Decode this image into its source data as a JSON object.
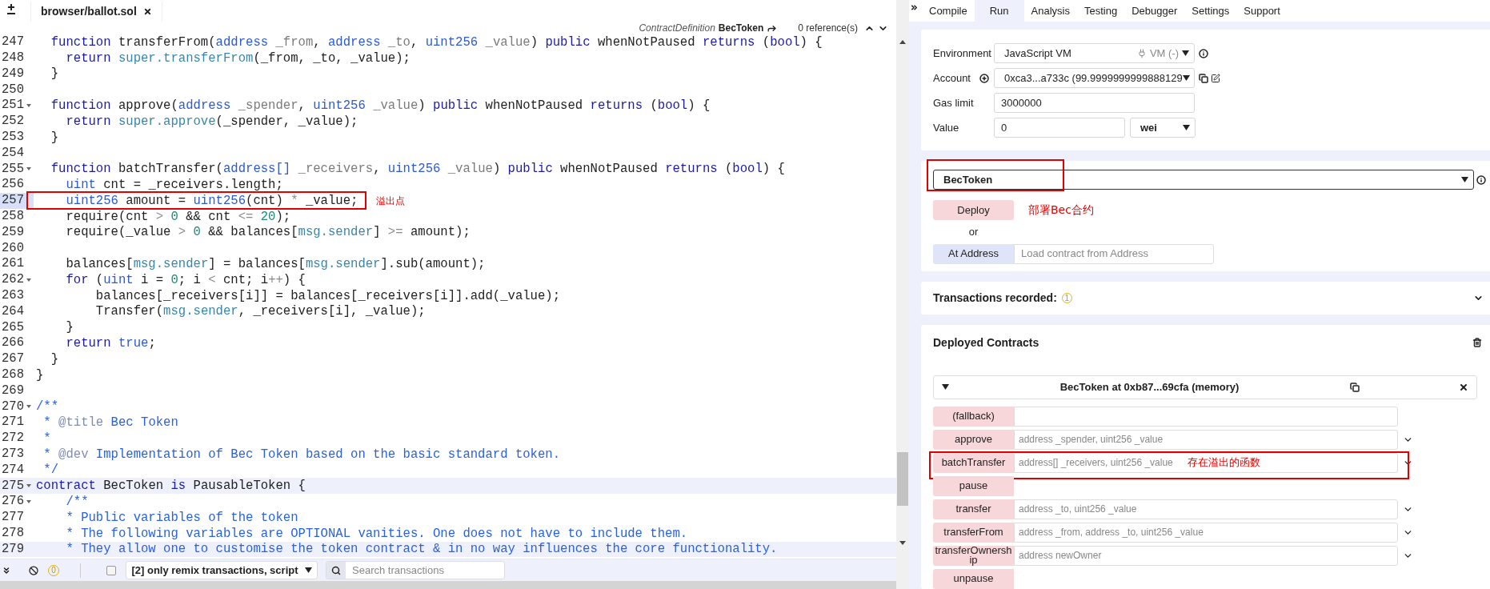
{
  "editor": {
    "file_tab": "browser/ballot.sol",
    "reference_bar": {
      "definition": "ContractDefinition",
      "name": "BecToken",
      "references": "0 reference(s)"
    },
    "lines": [
      {
        "number": "247",
        "foldable": false,
        "selected": false,
        "highlighted": false,
        "segments": [
          {
            "text": "  function",
            "kind": "keyword"
          },
          {
            "text": " transferFrom(",
            "kind": "plain"
          },
          {
            "text": "address",
            "kind": "type"
          },
          {
            "text": " _from",
            "kind": "param"
          },
          {
            "text": ", ",
            "kind": "plain"
          },
          {
            "text": "address",
            "kind": "type"
          },
          {
            "text": " _to",
            "kind": "param"
          },
          {
            "text": ", ",
            "kind": "plain"
          },
          {
            "text": "uint256",
            "kind": "type"
          },
          {
            "text": " _value",
            "kind": "param"
          },
          {
            "text": ") ",
            "kind": "plain"
          },
          {
            "text": "public",
            "kind": "keyword"
          },
          {
            "text": " whenNotPaused ",
            "kind": "plain"
          },
          {
            "text": "returns",
            "kind": "keyword"
          },
          {
            "text": " (",
            "kind": "plain"
          },
          {
            "text": "bool",
            "kind": "keyword"
          },
          {
            "text": ") {",
            "kind": "plain"
          }
        ]
      },
      {
        "number": "248",
        "foldable": false,
        "selected": false,
        "highlighted": false,
        "segments": [
          {
            "text": "    return",
            "kind": "keyword"
          },
          {
            "text": " super.transferFrom",
            "kind": "builtin"
          },
          {
            "text": "(_from, _to, _value);",
            "kind": "plain"
          }
        ]
      },
      {
        "number": "249",
        "foldable": false,
        "selected": false,
        "highlighted": false,
        "segments": [
          {
            "text": "  }",
            "kind": "plain"
          }
        ]
      },
      {
        "number": "250",
        "foldable": false,
        "selected": false,
        "highlighted": false
      },
      {
        "number": "251",
        "foldable": true,
        "selected": false,
        "highlighted": false,
        "segments": [
          {
            "text": "  function",
            "kind": "keyword"
          },
          {
            "text": " approve(",
            "kind": "plain"
          },
          {
            "text": "address",
            "kind": "type"
          },
          {
            "text": " _spender",
            "kind": "param"
          },
          {
            "text": ", ",
            "kind": "plain"
          },
          {
            "text": "uint256",
            "kind": "type"
          },
          {
            "text": " _value",
            "kind": "param"
          },
          {
            "text": ") ",
            "kind": "plain"
          },
          {
            "text": "public",
            "kind": "keyword"
          },
          {
            "text": " whenNotPaused ",
            "kind": "plain"
          },
          {
            "text": "returns",
            "kind": "keyword"
          },
          {
            "text": " (",
            "kind": "plain"
          },
          {
            "text": "bool",
            "kind": "keyword"
          },
          {
            "text": ") {",
            "kind": "plain"
          }
        ]
      },
      {
        "number": "252",
        "foldable": false,
        "selected": false,
        "highlighted": false,
        "segments": [
          {
            "text": "    return",
            "kind": "keyword"
          },
          {
            "text": " super.approve",
            "kind": "builtin"
          },
          {
            "text": "(_spender, _value);",
            "kind": "plain"
          }
        ]
      },
      {
        "number": "253",
        "foldable": false,
        "selected": false,
        "highlighted": false,
        "segments": [
          {
            "text": "  }",
            "kind": "plain"
          }
        ]
      },
      {
        "number": "254",
        "foldable": false,
        "selected": false,
        "highlighted": false
      },
      {
        "number": "255",
        "foldable": true,
        "selected": false,
        "highlighted": false,
        "segments": [
          {
            "text": "  function",
            "kind": "keyword"
          },
          {
            "text": " batchTransfer(",
            "kind": "plain"
          },
          {
            "text": "address[]",
            "kind": "type"
          },
          {
            "text": " _receivers",
            "kind": "param"
          },
          {
            "text": ", ",
            "kind": "plain"
          },
          {
            "text": "uint256",
            "kind": "type"
          },
          {
            "text": " _value",
            "kind": "param"
          },
          {
            "text": ") ",
            "kind": "plain"
          },
          {
            "text": "public",
            "kind": "keyword"
          },
          {
            "text": " whenNotPaused ",
            "kind": "plain"
          },
          {
            "text": "returns",
            "kind": "keyword"
          },
          {
            "text": " (",
            "kind": "plain"
          },
          {
            "text": "bool",
            "kind": "keyword"
          },
          {
            "text": ") {",
            "kind": "plain"
          }
        ]
      },
      {
        "number": "256",
        "foldable": false,
        "selected": false,
        "highlighted": false,
        "segments": [
          {
            "text": "    uint",
            "kind": "type"
          },
          {
            "text": " cnt = _receivers.length;",
            "kind": "plain"
          }
        ]
      },
      {
        "number": "257",
        "foldable": false,
        "selected": true,
        "highlighted": false,
        "annotation": "溢出点",
        "segments": [
          {
            "text": "    uint256",
            "kind": "type"
          },
          {
            "text": " amount = ",
            "kind": "plain"
          },
          {
            "text": "uint256",
            "kind": "type"
          },
          {
            "text": "(cnt) ",
            "kind": "plain"
          },
          {
            "text": "*",
            "kind": "operator"
          },
          {
            "text": " _value;",
            "kind": "plain"
          }
        ]
      },
      {
        "number": "258",
        "foldable": false,
        "selected": false,
        "highlighted": false,
        "segments": [
          {
            "text": "    require(cnt ",
            "kind": "plain"
          },
          {
            "text": ">",
            "kind": "operator"
          },
          {
            "text": " 0",
            "kind": "number"
          },
          {
            "text": " && cnt ",
            "kind": "plain"
          },
          {
            "text": "<=",
            "kind": "operator"
          },
          {
            "text": " 20",
            "kind": "number"
          },
          {
            "text": ");",
            "kind": "plain"
          }
        ]
      },
      {
        "number": "259",
        "foldable": false,
        "selected": false,
        "highlighted": false,
        "segments": [
          {
            "text": "    require(_value ",
            "kind": "plain"
          },
          {
            "text": ">",
            "kind": "operator"
          },
          {
            "text": " 0",
            "kind": "number"
          },
          {
            "text": " && balances[",
            "kind": "plain"
          },
          {
            "text": "msg.sender",
            "kind": "builtin"
          },
          {
            "text": "] ",
            "kind": "plain"
          },
          {
            "text": ">=",
            "kind": "operator"
          },
          {
            "text": " amount);",
            "kind": "plain"
          }
        ]
      },
      {
        "number": "260",
        "foldable": false,
        "selected": false,
        "highlighted": false
      },
      {
        "number": "261",
        "foldable": false,
        "selected": false,
        "highlighted": false,
        "segments": [
          {
            "text": "    balances[",
            "kind": "plain"
          },
          {
            "text": "msg.sender",
            "kind": "builtin"
          },
          {
            "text": "] = balances[",
            "kind": "plain"
          },
          {
            "text": "msg.sender",
            "kind": "builtin"
          },
          {
            "text": "].sub(amount);",
            "kind": "plain"
          }
        ]
      },
      {
        "number": "262",
        "foldable": true,
        "selected": false,
        "highlighted": false,
        "segments": [
          {
            "text": "    for",
            "kind": "keyword"
          },
          {
            "text": " (",
            "kind": "plain"
          },
          {
            "text": "uint",
            "kind": "type"
          },
          {
            "text": " i = ",
            "kind": "plain"
          },
          {
            "text": "0",
            "kind": "number"
          },
          {
            "text": "; i ",
            "kind": "plain"
          },
          {
            "text": "<",
            "kind": "operator"
          },
          {
            "text": " cnt; i",
            "kind": "plain"
          },
          {
            "text": "++",
            "kind": "operator"
          },
          {
            "text": ") {",
            "kind": "plain"
          }
        ]
      },
      {
        "number": "263",
        "foldable": false,
        "selected": false,
        "highlighted": false,
        "segments": [
          {
            "text": "        balances[_receivers[i]] = balances[_receivers[i]].add(_value);",
            "kind": "plain"
          }
        ]
      },
      {
        "number": "264",
        "foldable": false,
        "selected": false,
        "highlighted": false,
        "segments": [
          {
            "text": "        Transfer(",
            "kind": "plain"
          },
          {
            "text": "msg.sender",
            "kind": "builtin"
          },
          {
            "text": ", _receivers[i], _value);",
            "kind": "plain"
          }
        ]
      },
      {
        "number": "265",
        "foldable": false,
        "selected": false,
        "highlighted": false,
        "segments": [
          {
            "text": "    }",
            "kind": "plain"
          }
        ]
      },
      {
        "number": "266",
        "foldable": false,
        "selected": false,
        "highlighted": false,
        "segments": [
          {
            "text": "    return",
            "kind": "keyword"
          },
          {
            "text": " true",
            "kind": "type"
          },
          {
            "text": ";",
            "kind": "plain"
          }
        ]
      },
      {
        "number": "267",
        "foldable": false,
        "selected": false,
        "highlighted": false,
        "segments": [
          {
            "text": "  }",
            "kind": "plain"
          }
        ]
      },
      {
        "number": "268",
        "foldable": false,
        "selected": false,
        "highlighted": false,
        "segments": [
          {
            "text": "}",
            "kind": "plain"
          }
        ]
      },
      {
        "number": "269",
        "foldable": false,
        "selected": false,
        "highlighted": false
      },
      {
        "number": "270",
        "foldable": true,
        "selected": false,
        "highlighted": false,
        "segments": [
          {
            "text": "/**",
            "kind": "comment"
          }
        ]
      },
      {
        "number": "271",
        "foldable": false,
        "selected": false,
        "highlighted": false,
        "segments": [
          {
            "text": " * ",
            "kind": "comment"
          },
          {
            "text": "@title",
            "kind": "doctag"
          },
          {
            "text": " Bec Token",
            "kind": "comment"
          }
        ]
      },
      {
        "number": "272",
        "foldable": false,
        "selected": false,
        "highlighted": false,
        "segments": [
          {
            "text": " *",
            "kind": "comment"
          }
        ]
      },
      {
        "number": "273",
        "foldable": false,
        "selected": false,
        "highlighted": false,
        "segments": [
          {
            "text": " * ",
            "kind": "comment"
          },
          {
            "text": "@dev",
            "kind": "doctag"
          },
          {
            "text": " Implementation of Bec Token based on the basic standard token.",
            "kind": "comment"
          }
        ]
      },
      {
        "number": "274",
        "foldable": false,
        "selected": false,
        "highlighted": false,
        "segments": [
          {
            "text": " */",
            "kind": "comment"
          }
        ]
      },
      {
        "number": "275",
        "foldable": true,
        "selected": false,
        "highlighted": true,
        "segments": [
          {
            "text": "contract",
            "kind": "keyword"
          },
          {
            "text": " BecToken ",
            "kind": "plain"
          },
          {
            "text": "is",
            "kind": "keyword"
          },
          {
            "text": " PausableToken {",
            "kind": "plain"
          }
        ]
      },
      {
        "number": "276",
        "foldable": true,
        "selected": false,
        "highlighted": false,
        "segments": [
          {
            "text": "    /**",
            "kind": "comment"
          }
        ]
      },
      {
        "number": "277",
        "foldable": false,
        "selected": false,
        "highlighted": false,
        "segments": [
          {
            "text": "    * Public variables of the token",
            "kind": "comment"
          }
        ]
      },
      {
        "number": "278",
        "foldable": false,
        "selected": false,
        "highlighted": false,
        "segments": [
          {
            "text": "    * The following variables are OPTIONAL vanities. One does not have to include them.",
            "kind": "comment"
          }
        ]
      },
      {
        "number": "279",
        "foldable": false,
        "selected": false,
        "highlighted": true,
        "segments": [
          {
            "text": "    * They allow one to customise the token contract & in no way influences the core functionality.",
            "kind": "comment"
          }
        ]
      }
    ],
    "bottom_bar": {
      "count": "0",
      "filter_checked": false,
      "filter": "[2] only remix transactions, script",
      "search_placeholder": "Search transactions"
    }
  },
  "run_panel": {
    "tabs": [
      {
        "label": "Compile",
        "selected": false
      },
      {
        "label": "Run",
        "selected": true
      },
      {
        "label": "Analysis",
        "selected": false
      },
      {
        "label": "Testing",
        "selected": false
      },
      {
        "label": "Debugger",
        "selected": false
      },
      {
        "label": "Settings",
        "selected": false
      },
      {
        "label": "Support",
        "selected": false
      }
    ],
    "environment": {
      "label": "Environment",
      "value": "JavaScript VM",
      "network": "VM (-)"
    },
    "account": {
      "label": "Account",
      "value": "0xca3...a733c (99.9999999999888129"
    },
    "gas_limit": {
      "label": "Gas limit",
      "value": "3000000"
    },
    "value": {
      "label": "Value",
      "value": "0",
      "unit": "wei"
    },
    "contract_select": {
      "value": "BecToken",
      "highlighted": true
    },
    "deploy": {
      "label": "Deploy",
      "annotation": "部署Bec合约"
    },
    "or": "or",
    "at_address": {
      "label": "At Address",
      "placeholder": "Load contract from Address"
    },
    "transactions": {
      "label": "Transactions recorded:",
      "count": "1"
    },
    "deployed": {
      "title": "Deployed Contracts",
      "instance": {
        "title": "BecToken at 0xb87...69cfa (memory)",
        "functions": [
          {
            "name": "(fallback)",
            "input": true,
            "expandable": false,
            "highlighted": false
          },
          {
            "name": "approve",
            "input": true,
            "expandable": true,
            "highlighted": false,
            "placeholder": "address _spender, uint256 _value"
          },
          {
            "name": "batchTransfer",
            "input": true,
            "expandable": true,
            "highlighted": true,
            "placeholder": "address[] _receivers, uint256 _value",
            "annotation": "存在溢出的函数"
          },
          {
            "name": "pause",
            "input": false,
            "expandable": false,
            "highlighted": false
          },
          {
            "name": "transfer",
            "input": true,
            "expandable": true,
            "highlighted": false,
            "placeholder": "address _to, uint256 _value"
          },
          {
            "name": "transferFrom",
            "input": true,
            "expandable": true,
            "highlighted": false,
            "placeholder": "address _from, address _to, uint256 _value"
          },
          {
            "name": "transferOwnership",
            "input": true,
            "expandable": true,
            "highlighted": false,
            "placeholder": "address newOwner"
          },
          {
            "name": "unpause",
            "input": false,
            "expandable": false,
            "highlighted": false
          }
        ]
      }
    }
  }
}
